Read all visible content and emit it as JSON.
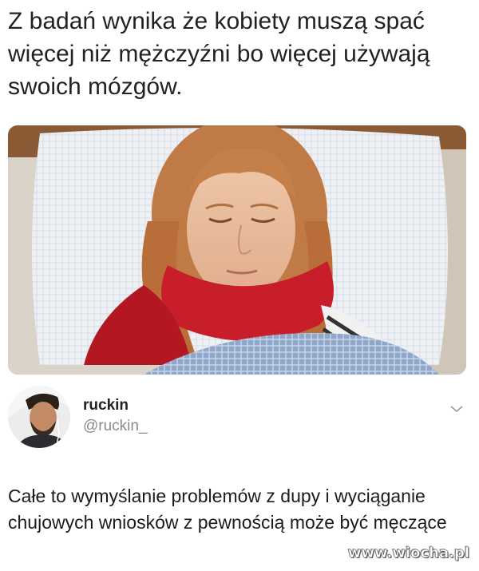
{
  "meme": {
    "caption": "Z badań wynika że kobiety muszą spać więcej niż mężczyźni bo więcej używają swoich mózgów."
  },
  "tweet": {
    "name": "ruckin",
    "handle": "@ruckin_",
    "text": "Całe to wymyślanie problemów z dupy i wyciąganie chujowych wniosków z pewnością może być męczące",
    "menu_icon": "chevron-down-icon"
  },
  "watermark": "www.wiocha.pl",
  "colors": {
    "scarf": "#c81e2a",
    "hair": "#c07a45",
    "handle": "#8a8a8a"
  }
}
